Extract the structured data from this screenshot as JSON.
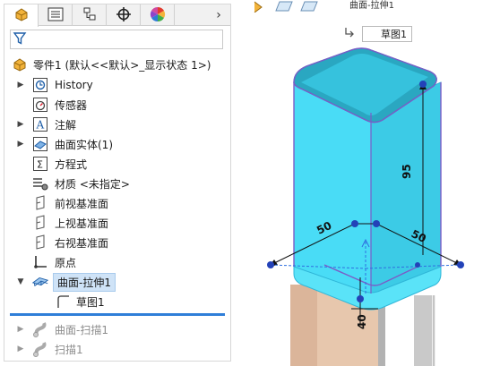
{
  "breadcrumb": {
    "text": "曲面-拉伸1"
  },
  "tree_root": {
    "label": "零件1 (默认<<默认>_显示状态 1>)"
  },
  "tabs": [
    {
      "name": "feature-manager",
      "icon": "part-icon",
      "active": true
    },
    {
      "name": "property-manager",
      "icon": "list-icon",
      "active": false
    },
    {
      "name": "configuration-manager",
      "icon": "config-icon",
      "active": false
    },
    {
      "name": "dimxpert-manager",
      "icon": "crosshair-icon",
      "active": false
    },
    {
      "name": "display-manager",
      "icon": "color-wheel-icon",
      "active": false
    }
  ],
  "tree": [
    {
      "label": "History",
      "icon": "history-icon",
      "expandable": true
    },
    {
      "label": "传感器",
      "icon": "sensor-icon",
      "expandable": false
    },
    {
      "label": "注解",
      "icon": "annotation-icon",
      "expandable": true
    },
    {
      "label": "曲面实体(1)",
      "icon": "surface-bodies-icon",
      "expandable": true
    },
    {
      "label": "方程式",
      "icon": "equation-icon",
      "expandable": false
    },
    {
      "label": "材质 <未指定>",
      "icon": "material-icon",
      "expandable": false
    },
    {
      "label": "前视基准面",
      "icon": "plane-icon",
      "expandable": false
    },
    {
      "label": "上视基准面",
      "icon": "plane-icon",
      "expandable": false
    },
    {
      "label": "右视基准面",
      "icon": "plane-icon",
      "expandable": false
    },
    {
      "label": "原点",
      "icon": "origin-icon",
      "expandable": false
    },
    {
      "label": "曲面-拉伸1",
      "icon": "surface-extrude-icon",
      "expandable": true,
      "expanded": true,
      "selected": true
    },
    {
      "label": "草图1",
      "icon": "sketch-icon",
      "sub": true
    }
  ],
  "tree_suppressed": [
    {
      "label": "曲面-扫描1",
      "icon": "surface-sweep-icon",
      "expandable": true
    },
    {
      "label": "扫描1",
      "icon": "sweep-icon",
      "expandable": true
    }
  ],
  "graphics": {
    "sketch_chip_label": "草图1",
    "dimensions": {
      "height": "95",
      "width_left": "50",
      "width_right": "50",
      "bottom": "40"
    }
  },
  "colors": {
    "surface": "#43d8f5",
    "surface_edge": "#2fb6d8",
    "selection": "#cfe3f7",
    "rollback": "#2f7ed8",
    "beige": "#e7c7ad"
  }
}
